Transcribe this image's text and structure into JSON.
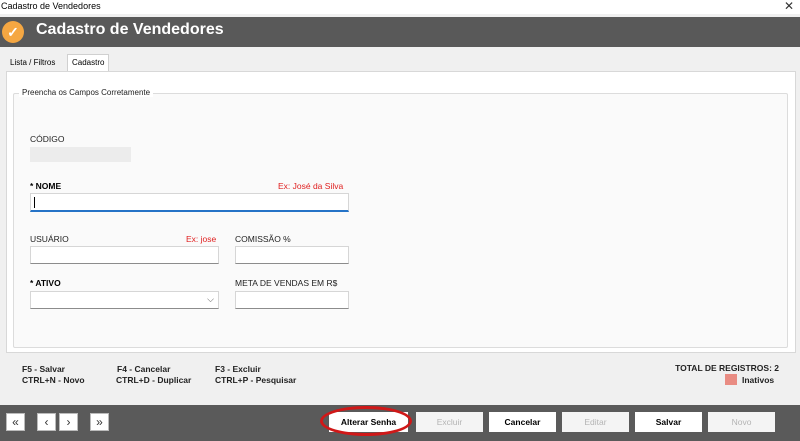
{
  "window": {
    "title": "Cadastro de Vendedores",
    "close_glyph": "✕"
  },
  "header": {
    "icon": "check-circle-icon",
    "icon_glyph": "✓",
    "title": "Cadastro de Vendedores",
    "accent": "#f5a742",
    "bar_color": "#595959"
  },
  "tabs": [
    {
      "label": "Lista / Filtros",
      "active": false
    },
    {
      "label": "Cadastro",
      "active": true
    }
  ],
  "form": {
    "legend": "Preencha os Campos Corretamente",
    "codigo": {
      "label": "CÓDIGO",
      "value": ""
    },
    "nome": {
      "label": "* NOME",
      "example": "Ex: José da Silva",
      "value": ""
    },
    "usuario": {
      "label": "USUÁRIO",
      "example": "Ex: jose",
      "value": ""
    },
    "comissao": {
      "label": "COMISSÃO %",
      "value": ""
    },
    "ativo": {
      "label": "* ATIVO",
      "value": ""
    },
    "meta": {
      "label": "META DE VENDAS EM R$",
      "value": ""
    }
  },
  "shortcuts": {
    "row1": [
      "F5 - Salvar",
      "F4 - Cancelar",
      "F3 - Excluir"
    ],
    "row2": [
      "CTRL+N - Novo",
      "CTRL+D - Duplicar",
      "CTRL+P - Pesquisar"
    ]
  },
  "summary": {
    "total_label": "TOTAL DE REGISTROS: 2",
    "legend_label": "Inativos",
    "legend_color": "#e98c83"
  },
  "nav": {
    "first": "«",
    "prev": "‹",
    "next": "›",
    "last": "»"
  },
  "actions": {
    "alterar_senha": "Alterar Senha",
    "excluir": "Excluir",
    "cancelar": "Cancelar",
    "editar": "Editar",
    "salvar": "Salvar",
    "novo": "Novo"
  },
  "annotation_color": "#d01818"
}
